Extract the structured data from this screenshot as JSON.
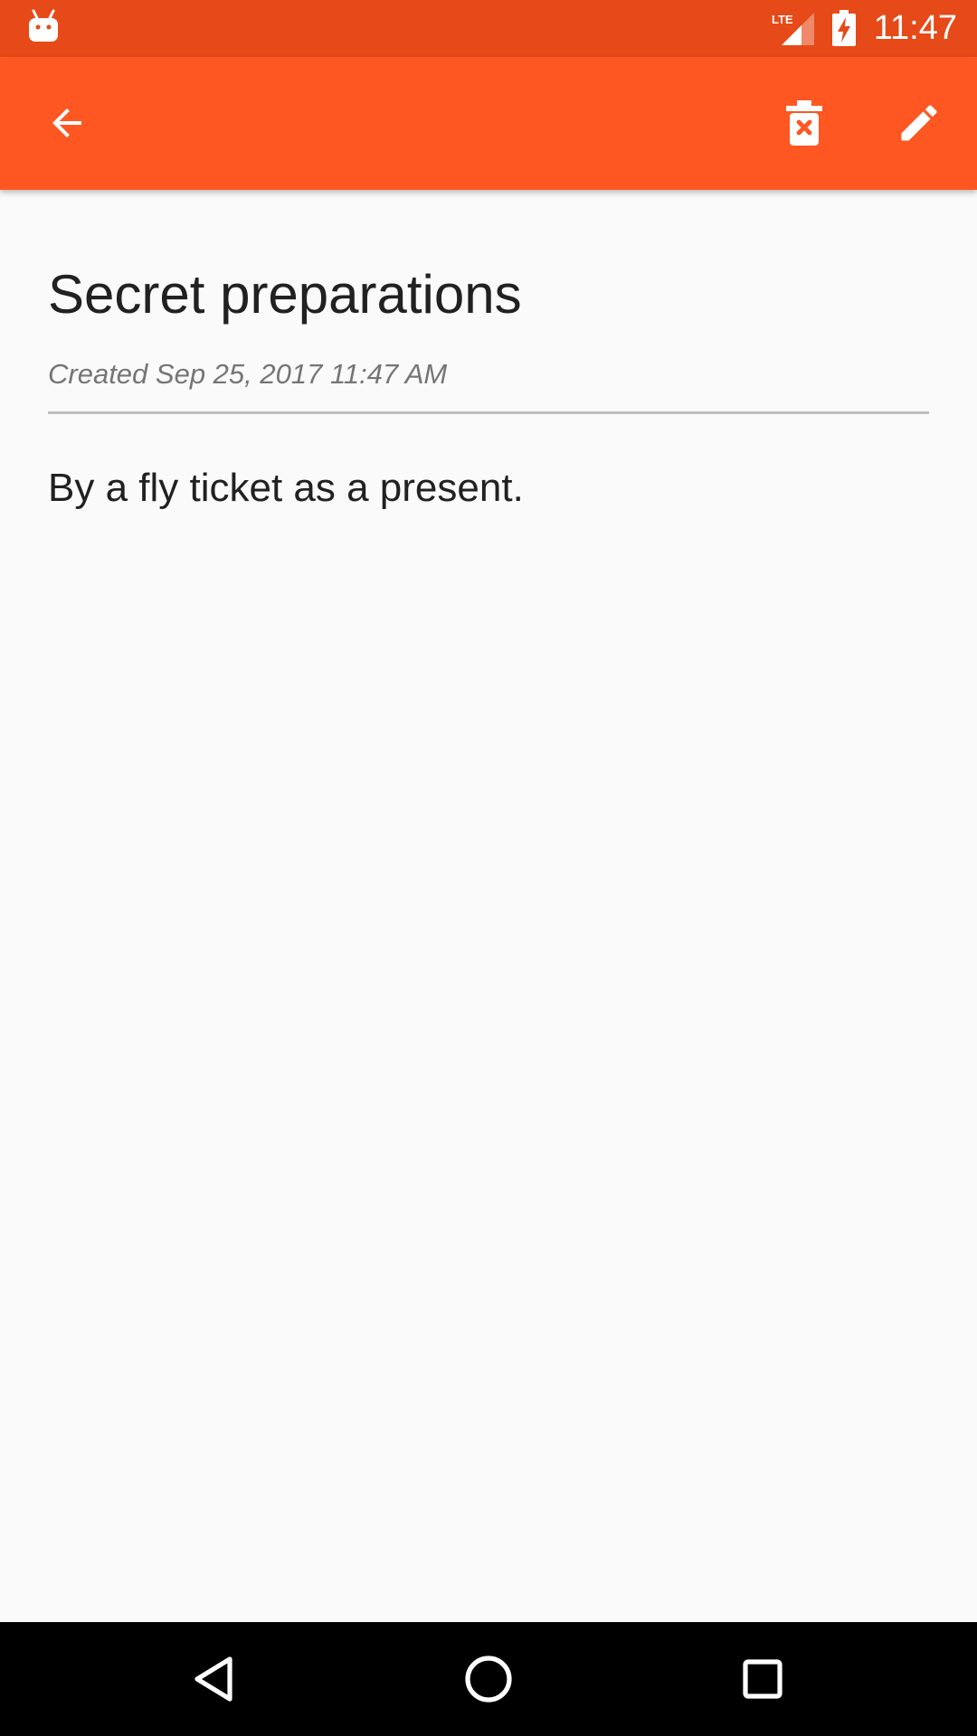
{
  "status_bar": {
    "time": "11:47",
    "network_label": "LTE",
    "icons": [
      "android-notification-icon",
      "lte-signal-icon",
      "battery-charging-icon"
    ]
  },
  "app_bar": {
    "background": "#FF5722",
    "actions": [
      "back-arrow-icon",
      "delete-icon",
      "edit-pencil-icon"
    ]
  },
  "note": {
    "title": "Secret preparations",
    "created": "Created Sep 25, 2017 11:47 AM",
    "body": "By a fly ticket as a present."
  },
  "nav_bar": {
    "icons": [
      "nav-back-icon",
      "nav-home-icon",
      "nav-recents-icon"
    ]
  },
  "colors": {
    "status_bar": "#E64A19",
    "app_bar": "#FF5722",
    "page_background": "#FAFAFA",
    "title_text": "#212121",
    "meta_text": "#757575",
    "divider": "#BDBDBD"
  }
}
